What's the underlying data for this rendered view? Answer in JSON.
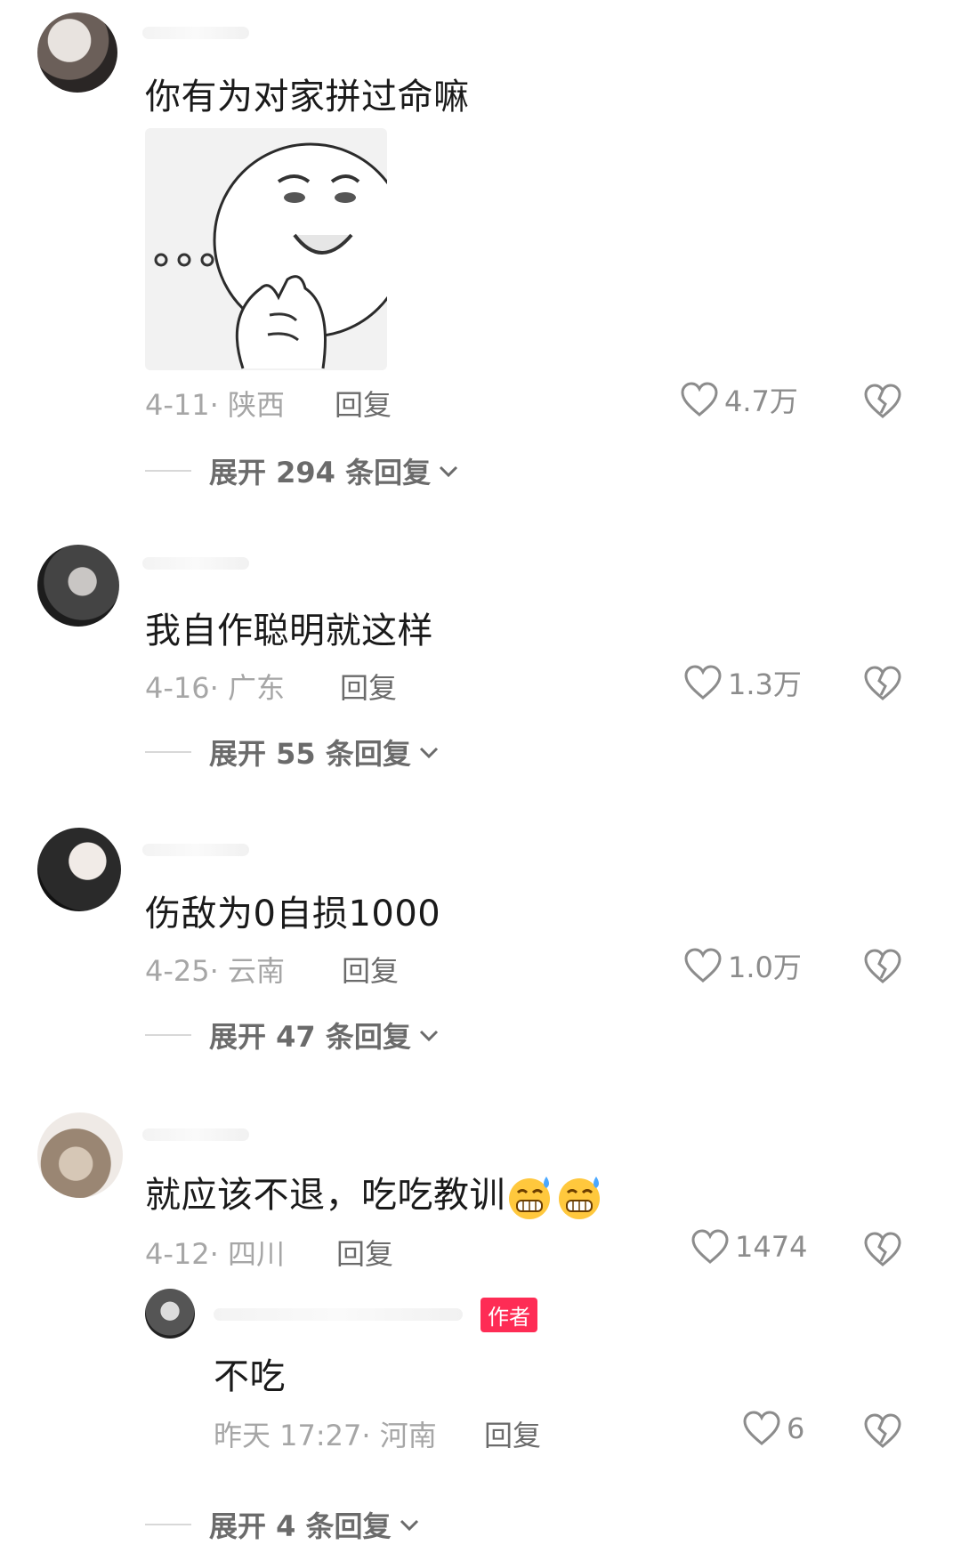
{
  "comments": [
    {
      "text": "你有为对家拼过命嘛",
      "date": "4-11",
      "location": "陕西",
      "reply_label": "回复",
      "likes": "4.7万",
      "expand_label": "展开 294 条回复"
    },
    {
      "text": "我自作聪明就这样",
      "date": "4-16",
      "location": "广东",
      "reply_label": "回复",
      "likes": "1.3万",
      "expand_label": "展开 55 条回复"
    },
    {
      "text": "伤敌为0自损1000",
      "date": "4-25",
      "location": "云南",
      "reply_label": "回复",
      "likes": "1.0万",
      "expand_label": "展开 47 条回复"
    },
    {
      "text": "就应该不退，吃吃教训",
      "date": "4-12",
      "location": "四川",
      "reply_label": "回复",
      "likes": "1474",
      "emoji_icon": "grimace-sweat-emoji",
      "expand_label": "展开 4 条回复"
    }
  ],
  "sub_reply": {
    "badge": "作者",
    "text": "不吃",
    "date": "昨天 17:27",
    "location": "河南",
    "reply_label": "回复",
    "likes": "6"
  },
  "icons": {
    "like": "heart-outline-icon",
    "dislike": "broken-heart-icon",
    "expand": "chevron-down-icon"
  },
  "colors": {
    "author_badge": "#fe2c55",
    "meta_text": "#a6a6a6"
  }
}
